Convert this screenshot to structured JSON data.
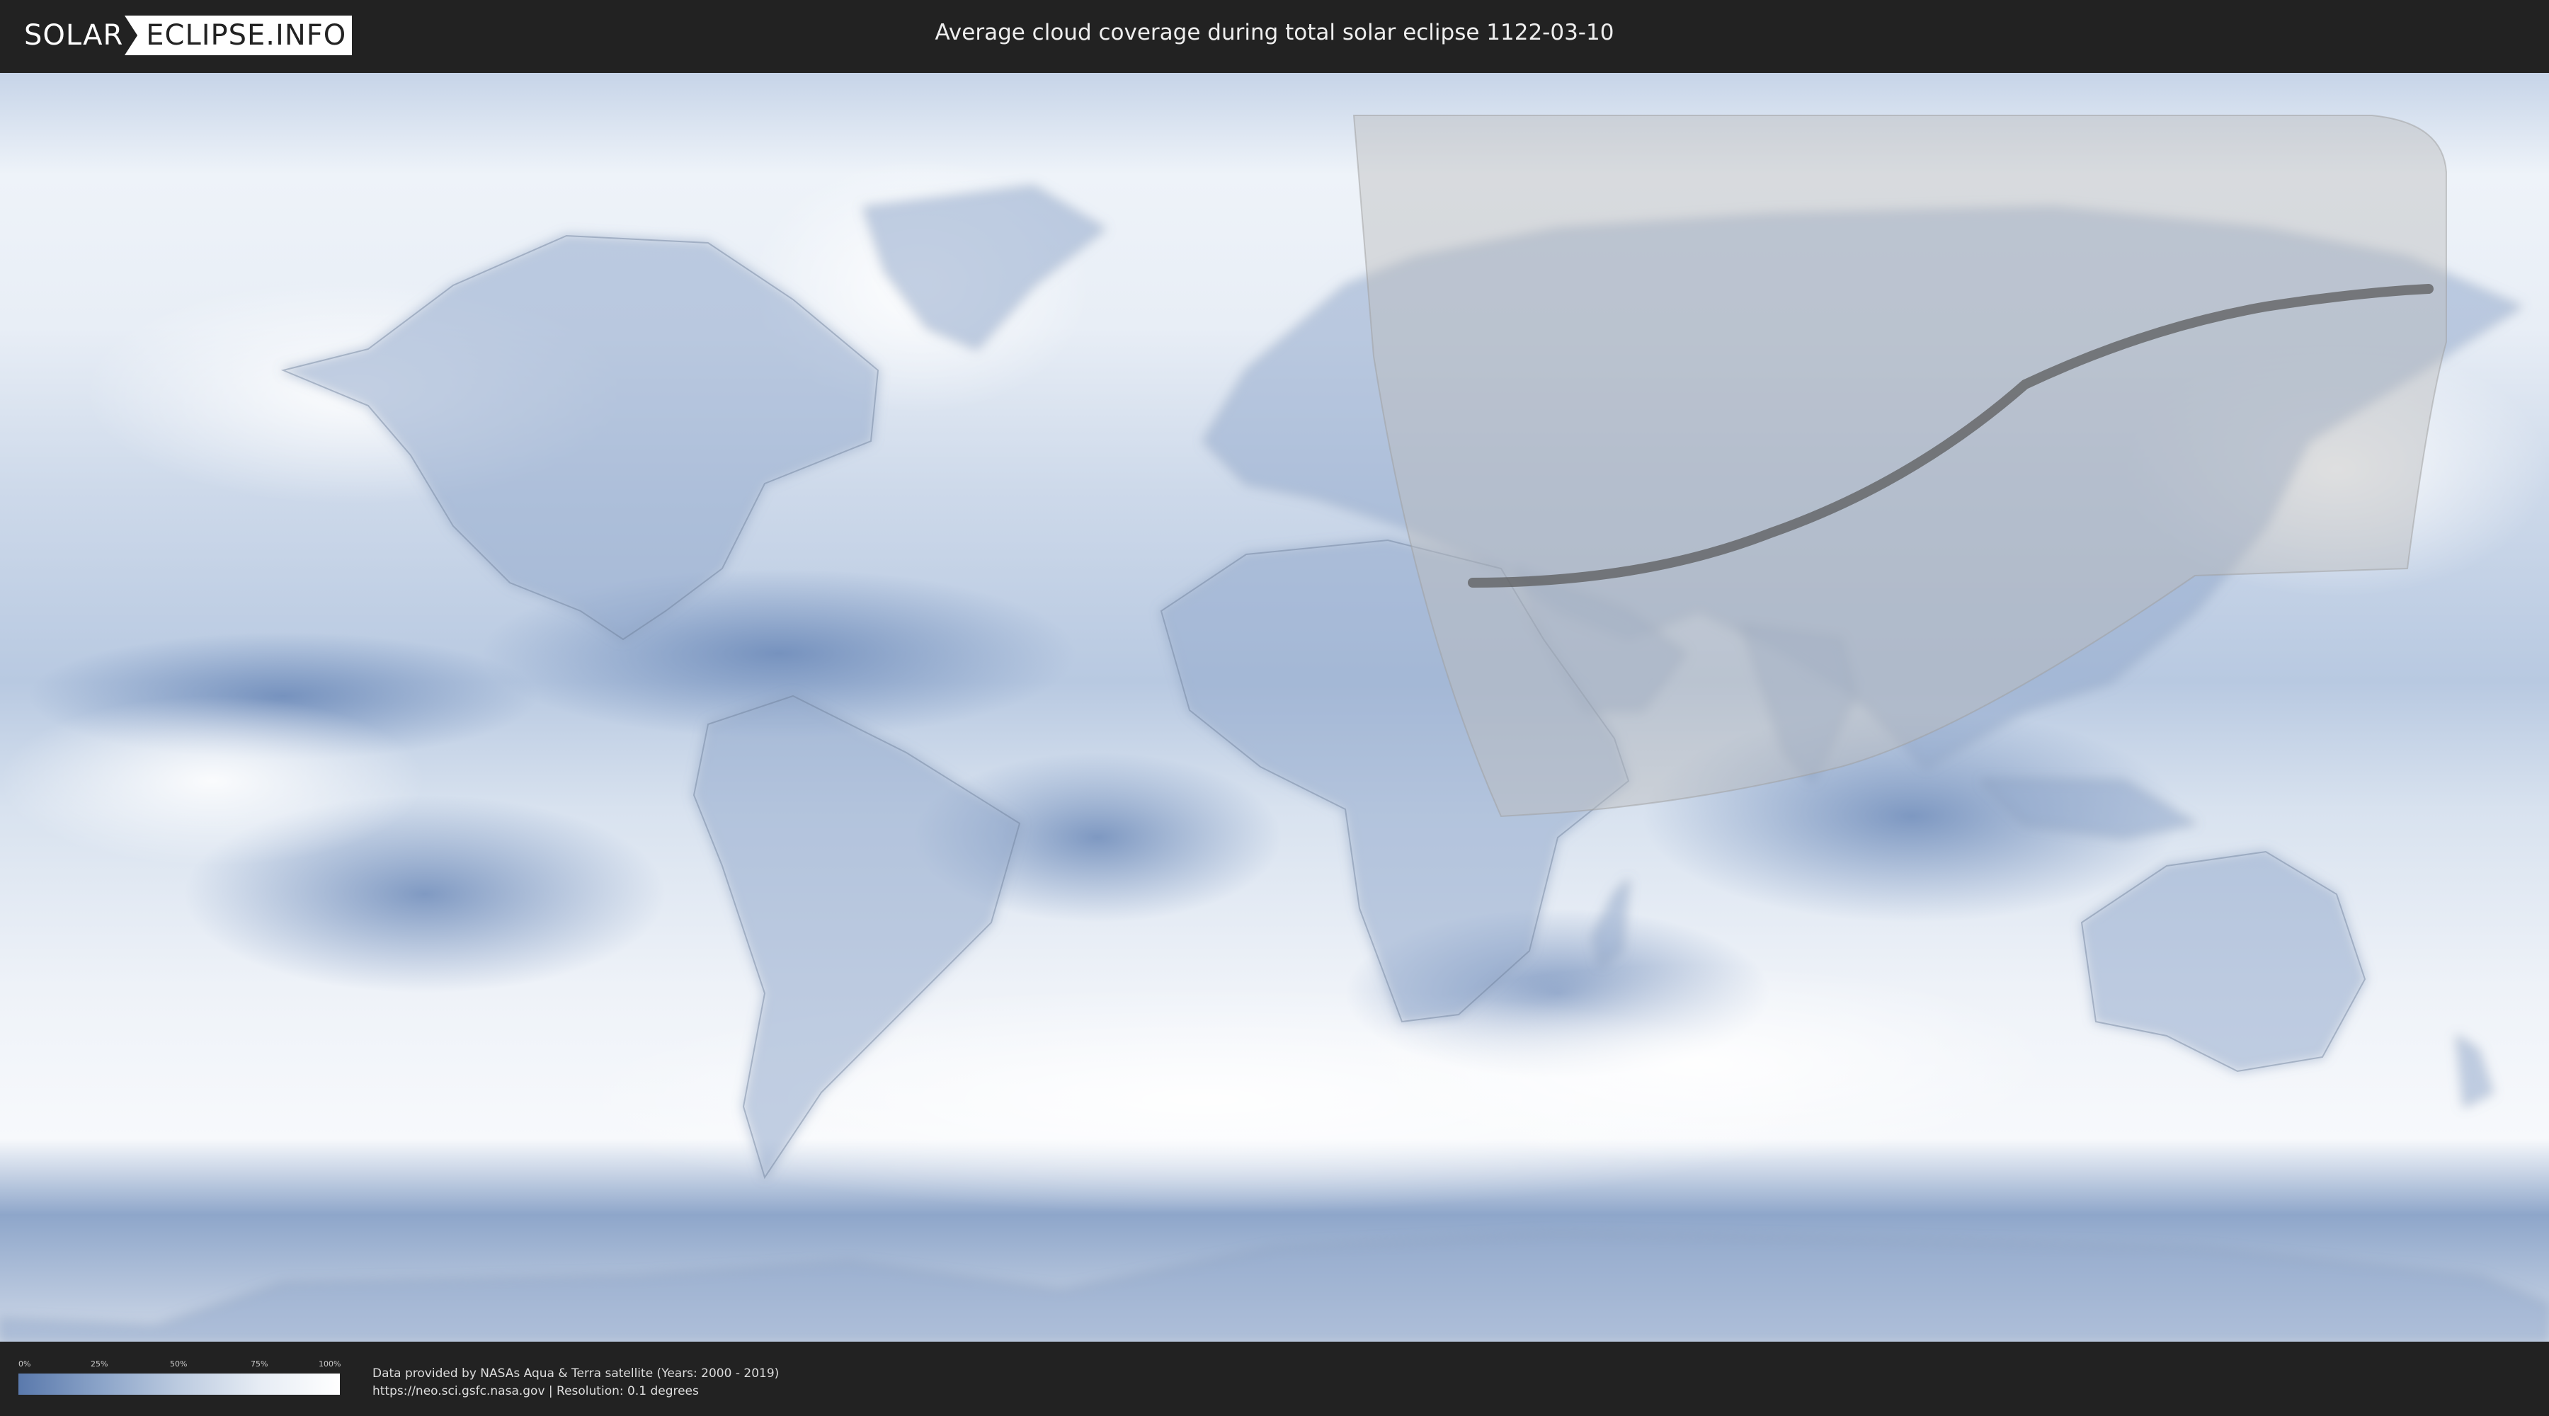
{
  "header": {
    "logo_left": "SOLAR",
    "logo_right": "ECLIPSE.INFO",
    "title": "Average cloud coverage during total solar eclipse 1122-03-10"
  },
  "map": {
    "theme_colors": {
      "ocean_clear": "#5f7fb2",
      "cloud_white": "#f7f9fc",
      "eclipse_overlay": "#bdbdbd",
      "totality_path": "#555555"
    }
  },
  "legend": {
    "ticks": [
      "0%",
      "25%",
      "50%",
      "75%",
      "100%"
    ],
    "gradient_colors": [
      "#5a79ac",
      "#ffffff"
    ]
  },
  "footer": {
    "credit_line_1": "Data provided by NASAs Aqua & Terra satellite (Years: 2000 - 2019)",
    "credit_line_2": "https://neo.sci.gsfc.nasa.gov | Resolution: 0.1 degrees"
  }
}
